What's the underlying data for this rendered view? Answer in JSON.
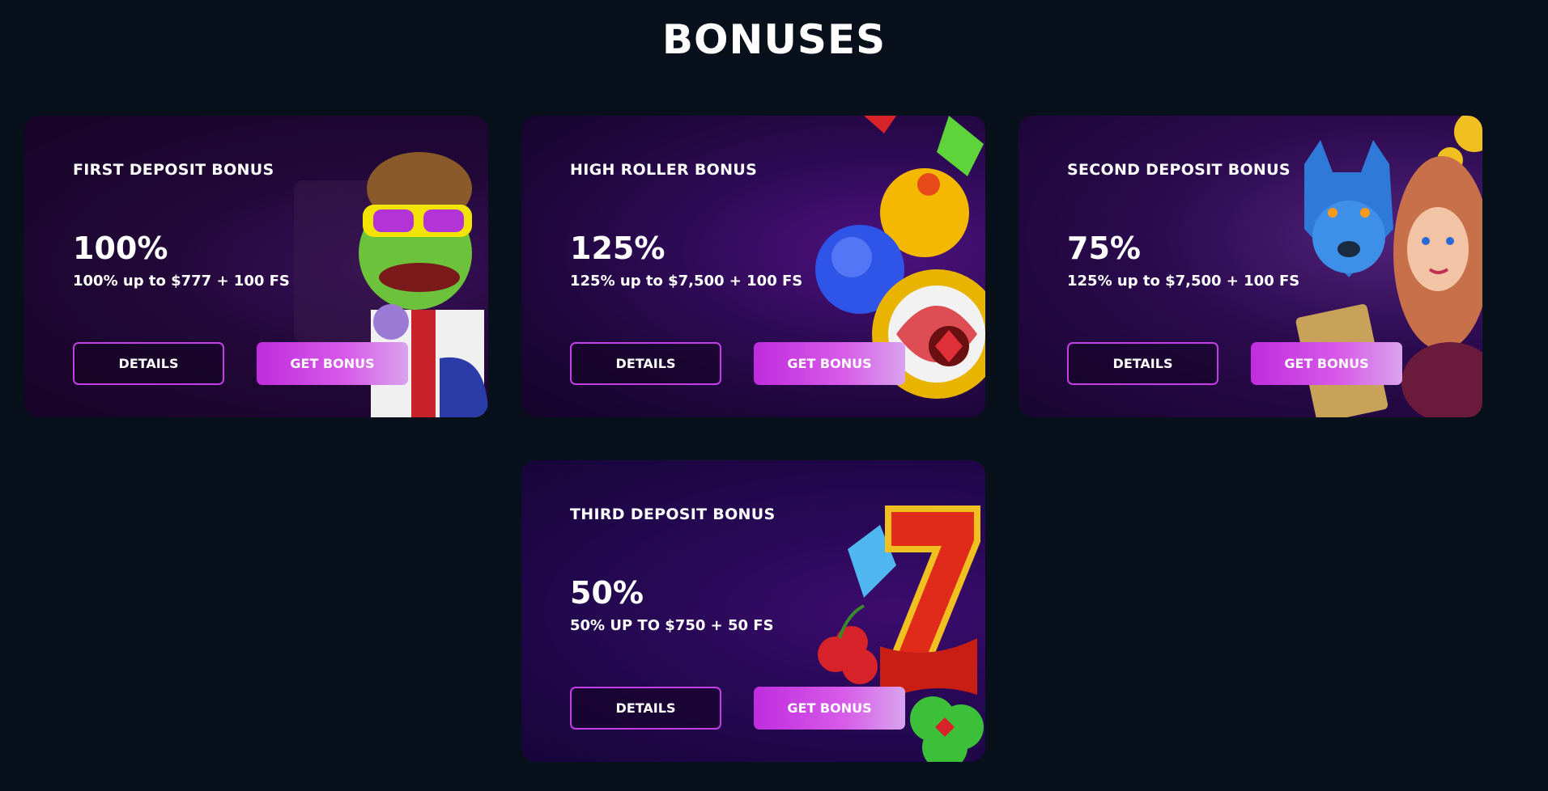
{
  "page": {
    "title": "BONUSES"
  },
  "cards": [
    {
      "title": "FIRST DEPOSIT BONUS",
      "percent": "100%",
      "description": "100% up to $777 + 100 FS",
      "details_label": "DETAILS",
      "bonus_label": "GET BONUS",
      "art_icon": "frog-icon"
    },
    {
      "title": "HIGH ROLLER BONUS",
      "percent": "125%",
      "description": "125% up to $7,500 + 100 FS",
      "details_label": "DETAILS",
      "bonus_label": "GET BONUS",
      "art_icon": "gems-icon"
    },
    {
      "title": "SECOND DEPOSIT BONUS",
      "percent": "75%",
      "description": "125% up to $7,500 + 100 FS",
      "details_label": "DETAILS",
      "bonus_label": "GET BONUS",
      "art_icon": "wolf-princess-icon"
    },
    {
      "title": "THIRD DEPOSIT BONUS",
      "percent": "50%",
      "description": "50% UP TO $750 + 50 FS",
      "details_label": "DETAILS",
      "bonus_label": "GET BONUS",
      "art_icon": "lucky-seven-icon"
    }
  ],
  "colors": {
    "background": "#08111b",
    "button_border": "#c23fe6",
    "button_gradient_start": "#c02cde",
    "button_gradient_end": "#d9a3ee"
  }
}
